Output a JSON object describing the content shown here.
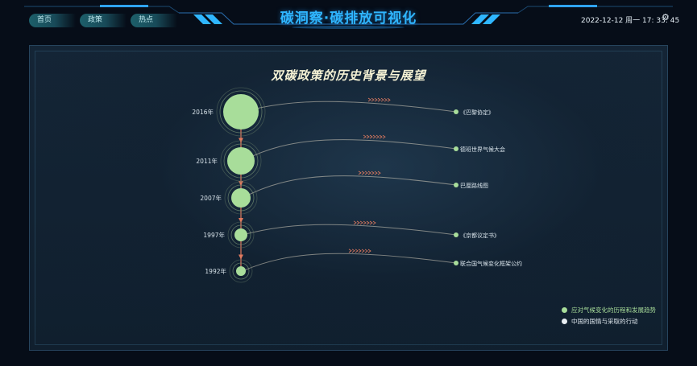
{
  "header": {
    "title": "碳洞察·碳排放可视化",
    "datetime": "2022-12-12 周一 17: 33: 45",
    "nav": [
      {
        "label": "首页"
      },
      {
        "label": "政策"
      },
      {
        "label": "热点"
      }
    ],
    "settings_icon": "gear-icon"
  },
  "panel": {
    "title": "双碳政策的历史背景与展望"
  },
  "chart_data": {
    "type": "timeline",
    "title": "双碳政策的历史背景与展望",
    "nodes": [
      {
        "year": "2016年",
        "event": "《巴黎协定》",
        "size": 5
      },
      {
        "year": "2011年",
        "event": "德班世界气候大会",
        "size": 4
      },
      {
        "year": "2007年",
        "event": "巴厘路线图",
        "size": 3
      },
      {
        "year": "1997年",
        "event": "《京都议定书》",
        "size": 2
      },
      {
        "year": "1992年",
        "event": "联合国气候变化框架公约",
        "size": 1
      }
    ],
    "legend": [
      {
        "label": "应对气候变化的历程和发展趋势",
        "color": "#a8dd9a"
      },
      {
        "label": "中国的国情与采取的行动",
        "color": "#e8eef2"
      }
    ],
    "colors": {
      "node": "#a8dd9a",
      "flow": "#e07a5f",
      "curve": "#d9d2c0"
    }
  }
}
